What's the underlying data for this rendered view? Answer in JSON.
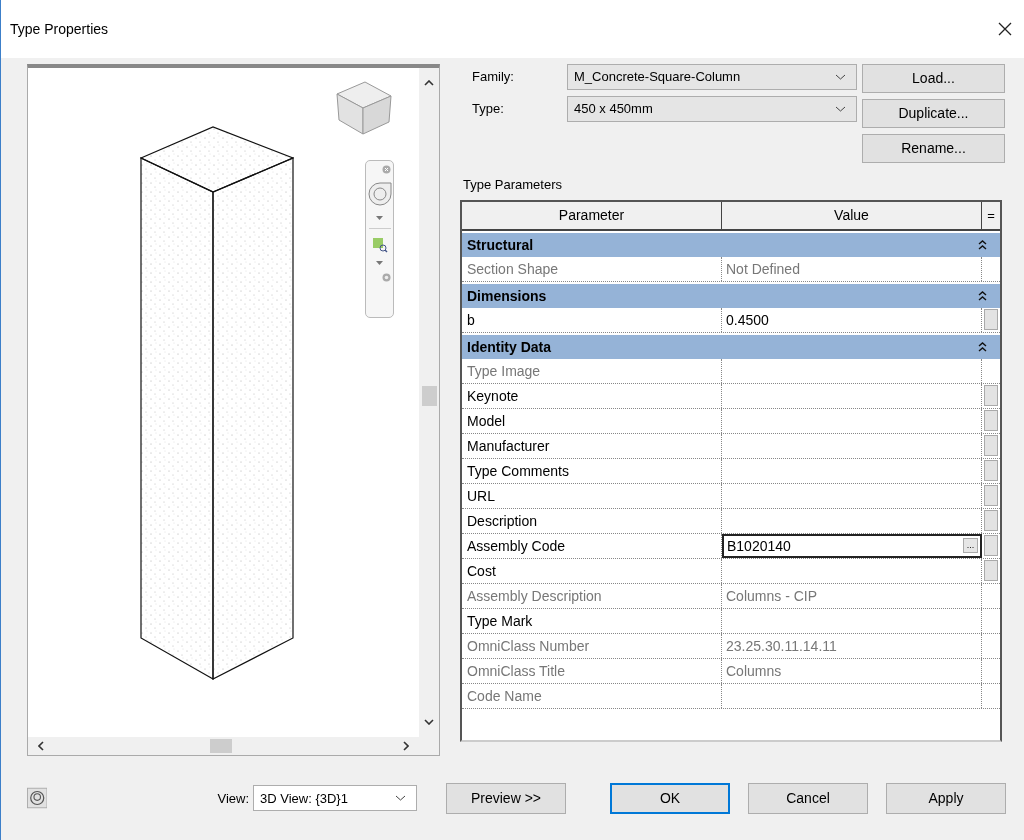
{
  "window": {
    "title": "Type Properties"
  },
  "preview": {
    "view_label": "View:",
    "view_value": "3D View: {3D}1"
  },
  "family": {
    "label": "Family:",
    "value": "M_Concrete-Square-Column"
  },
  "type": {
    "label": "Type:",
    "value": "450 x 450mm"
  },
  "side_buttons": [
    "Load...",
    "Duplicate...",
    "Rename..."
  ],
  "type_parameters": {
    "title": "Type Parameters",
    "columns": [
      "Parameter",
      "Value"
    ],
    "column_3": "=",
    "rows": [
      {
        "kind": "group",
        "label": "Structural",
        "expanded": true
      },
      {
        "kind": "param",
        "name": "Section Shape",
        "value": "Not Defined",
        "readonly": true,
        "button": false,
        "selected": false
      },
      {
        "kind": "group",
        "label": "Dimensions",
        "expanded": true
      },
      {
        "kind": "param",
        "name": "b",
        "value": "0.4500",
        "readonly": false,
        "button": true,
        "selected": false
      },
      {
        "kind": "group",
        "label": "Identity Data",
        "expanded": true
      },
      {
        "kind": "param",
        "name": "Type Image",
        "readonly": true,
        "button": false,
        "selected": false
      },
      {
        "kind": "param",
        "name": "Keynote",
        "readonly": false,
        "button": true,
        "selected": false
      },
      {
        "kind": "param",
        "name": "Model",
        "readonly": false,
        "button": true,
        "selected": false
      },
      {
        "kind": "param",
        "name": "Manufacturer",
        "readonly": false,
        "button": true,
        "selected": false
      },
      {
        "kind": "param",
        "name": "Type Comments",
        "readonly": false,
        "button": true,
        "selected": false
      },
      {
        "kind": "param",
        "name": "URL",
        "readonly": false,
        "button": true,
        "selected": false
      },
      {
        "kind": "param",
        "name": "Description",
        "readonly": false,
        "button": true,
        "selected": false
      },
      {
        "kind": "param",
        "name": "Assembly Code",
        "value": "B1020140",
        "readonly": false,
        "button": true,
        "selected": true,
        "browse": "..."
      },
      {
        "kind": "param",
        "name": "Cost",
        "readonly": false,
        "button": true,
        "selected": false
      },
      {
        "kind": "param",
        "name": "Assembly Description",
        "value": "Columns - CIP",
        "readonly": true,
        "button": false,
        "selected": false
      },
      {
        "kind": "param",
        "name": "Type Mark",
        "readonly": false,
        "button": false,
        "selected": false
      },
      {
        "kind": "param",
        "name": "OmniClass Number",
        "value": "23.25.30.11.14.11",
        "readonly": true,
        "button": false,
        "selected": false
      },
      {
        "kind": "param",
        "name": "OmniClass Title",
        "value": "Columns",
        "readonly": true,
        "button": false,
        "selected": false
      },
      {
        "kind": "param",
        "name": "Code Name",
        "readonly": true,
        "button": false,
        "selected": false
      }
    ]
  },
  "buttons": [
    {
      "label": "Preview >>",
      "default": false
    },
    {
      "label": "OK",
      "default": true
    },
    {
      "label": "Cancel",
      "default": false
    },
    {
      "label": "Apply",
      "default": false
    }
  ]
}
